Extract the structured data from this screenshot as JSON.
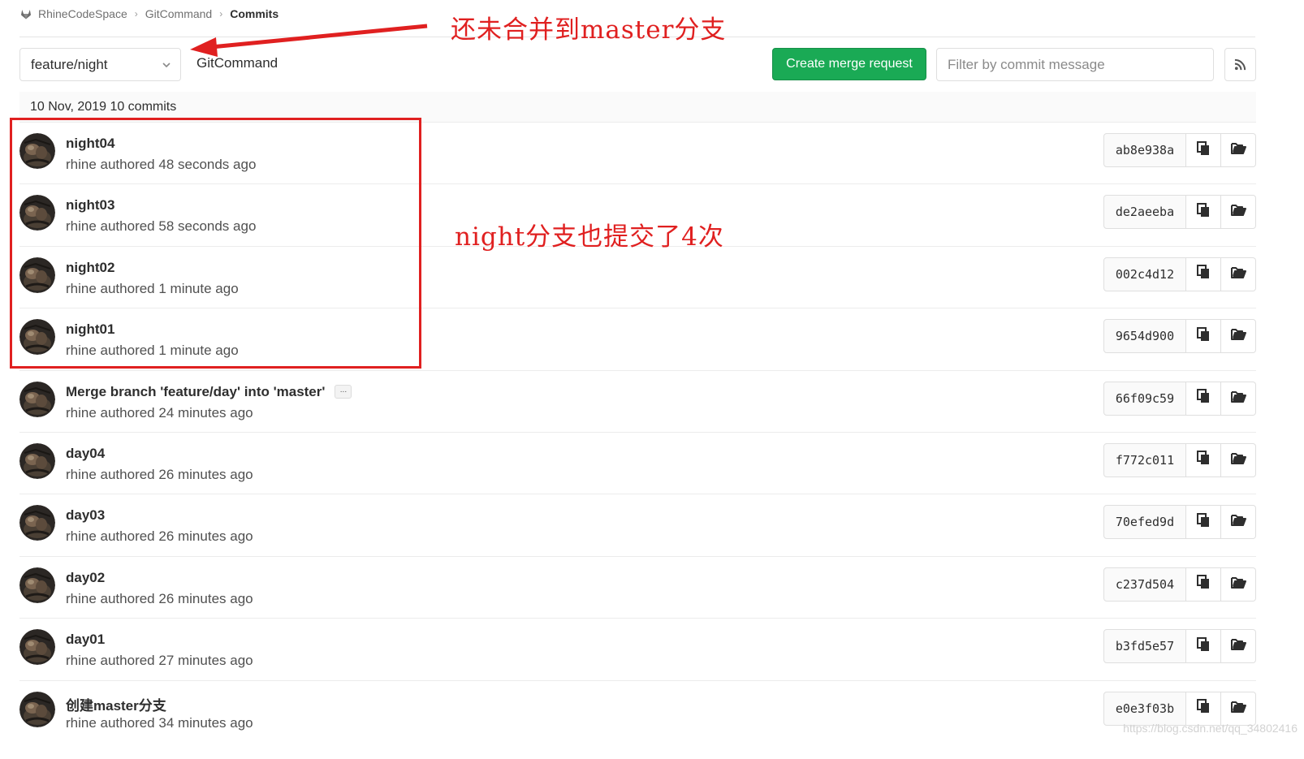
{
  "breadcrumb": {
    "items": [
      "RhineCodeSpace",
      "GitCommand",
      "Commits"
    ],
    "logo_icon": "gitlab-logo-icon"
  },
  "toolbar": {
    "branch_selected": "feature/night",
    "project_name": "GitCommand",
    "create_mr_label": "Create merge request",
    "filter_placeholder": "Filter by commit message",
    "rss_icon": "rss-icon"
  },
  "day_header": "10 Nov, 2019 10 commits",
  "commits": [
    {
      "title": "night04",
      "meta": "rhine authored 48 seconds ago",
      "sha": "ab8e938a"
    },
    {
      "title": "night03",
      "meta": "rhine authored 58 seconds ago",
      "sha": "de2aeeba"
    },
    {
      "title": "night02",
      "meta": "rhine authored 1 minute ago",
      "sha": "002c4d12"
    },
    {
      "title": "night01",
      "meta": "rhine authored 1 minute ago",
      "sha": "9654d900"
    },
    {
      "title": "Merge branch 'feature/day' into 'master'",
      "meta": "rhine authored 24 minutes ago",
      "sha": "66f09c59",
      "has_ellipsis": true,
      "ellipsis": "..."
    },
    {
      "title": "day04",
      "meta": "rhine authored 26 minutes ago",
      "sha": "f772c011"
    },
    {
      "title": "day03",
      "meta": "rhine authored 26 minutes ago",
      "sha": "70efed9d"
    },
    {
      "title": "day02",
      "meta": "rhine authored 26 minutes ago",
      "sha": "c237d504"
    },
    {
      "title": "day01",
      "meta": "rhine authored 27 minutes ago",
      "sha": "b3fd5e57"
    },
    {
      "title": "创建master分支",
      "meta": "rhine authored 34 minutes ago",
      "sha": "e0e3f03b"
    }
  ],
  "annotations": {
    "note_top": "还未合并到master分支",
    "note_middle": "night分支也提交了4次",
    "annotation_color": "#e02020"
  },
  "watermark": "https://blog.csdn.net/qq_34802416",
  "colors": {
    "accent_green": "#1aaa55",
    "border": "#dfdfdf"
  }
}
